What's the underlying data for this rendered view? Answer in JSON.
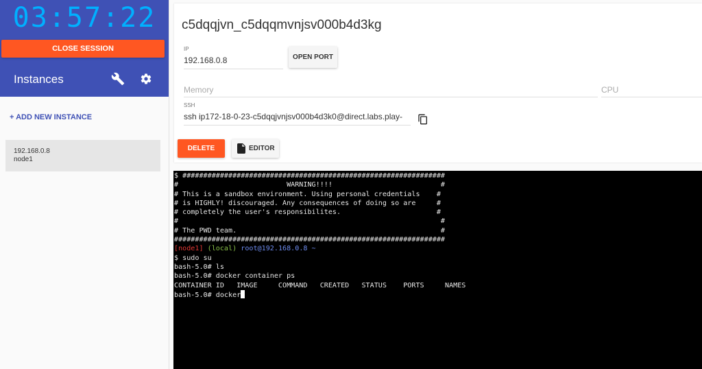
{
  "sidebar": {
    "session_timer": "03:57:22",
    "close_session_label": "CLOSE SESSION",
    "instances_title": "Instances",
    "add_instance_label": "+ ADD NEW INSTANCE",
    "instances": [
      {
        "ip": "192.168.0.8",
        "name": "node1"
      }
    ]
  },
  "instance": {
    "title": "c5dqqjvn_c5dqqmvnjsv000b4d3kg",
    "ip_label": "IP",
    "ip_value": "192.168.0.8",
    "open_port_label": "OPEN PORT",
    "memory_label": "Memory",
    "cpu_label": "CPU",
    "ssh_label": "SSH",
    "ssh_value": "ssh ip172-18-0-23-c5dqqjvnjsv000b4d3k0@direct.labs.play-",
    "delete_label": "DELETE",
    "editor_label": "EDITOR"
  },
  "terminal": {
    "banner": [
      "$ ###############################################################",
      "#                          WARNING!!!!                          #",
      "# This is a sandbox environment. Using personal credentials    #",
      "# is HIGHLY! discouraged. Any consequences of doing so are     #",
      "# completely the user's responsibilites.                       #",
      "#                                                               #",
      "# The PWD team.                                                 #",
      "#################################################################"
    ],
    "prompt_node": "[node1]",
    "prompt_local": "(local)",
    "prompt_host": "root@192.168.0.8 ~",
    "lines": [
      "$ sudo su",
      "bash-5.0# ls",
      "bash-5.0# docker container ps",
      "CONTAINER ID   IMAGE     COMMAND   CREATED   STATUS    PORTS     NAMES"
    ],
    "current_input": "bash-5.0# docker"
  },
  "colors": {
    "brand": "#3f51b5",
    "accent": "#ff5722",
    "timer": "#00b0ff"
  },
  "icons": {
    "settings_wrench": "wrench-icon",
    "settings_gear": "gear-icon",
    "copy": "copy-icon",
    "editor": "file-icon"
  }
}
